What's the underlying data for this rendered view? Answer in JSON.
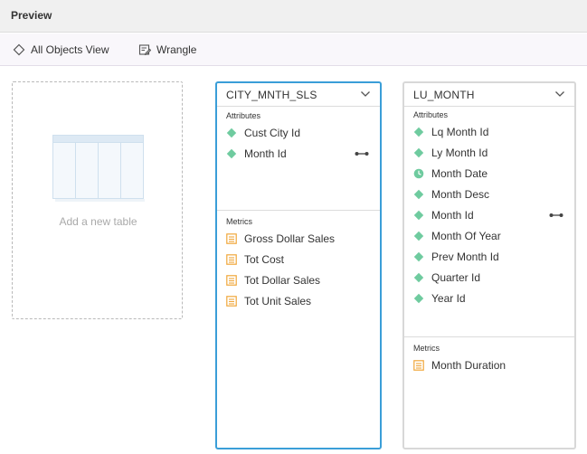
{
  "header": {
    "title": "Preview"
  },
  "toolbar": {
    "all_objects_label": "All Objects View",
    "wrangle_label": "Wrangle"
  },
  "add_table": {
    "label": "Add a new table"
  },
  "tables": [
    {
      "name": "CITY_MNTH_SLS",
      "attributes_label": "Attributes",
      "metrics_label": "Metrics",
      "attributes": [
        {
          "label": "Cust City Id",
          "icon": "attribute-diamond-icon"
        },
        {
          "label": "Month Id",
          "icon": "attribute-diamond-icon",
          "key": true
        }
      ],
      "metrics": [
        {
          "label": "Gross Dollar Sales",
          "icon": "metric-icon"
        },
        {
          "label": "Tot Cost",
          "icon": "metric-icon"
        },
        {
          "label": "Tot Dollar Sales",
          "icon": "metric-icon"
        },
        {
          "label": "Tot Unit Sales",
          "icon": "metric-icon"
        }
      ]
    },
    {
      "name": "LU_MONTH",
      "attributes_label": "Attributes",
      "metrics_label": "Metrics",
      "attributes": [
        {
          "label": "Lq Month Id",
          "icon": "attribute-diamond-icon"
        },
        {
          "label": "Ly Month Id",
          "icon": "attribute-diamond-icon"
        },
        {
          "label": "Month Date",
          "icon": "attribute-date-icon"
        },
        {
          "label": "Month Desc",
          "icon": "attribute-diamond-icon"
        },
        {
          "label": "Month Id",
          "icon": "attribute-diamond-icon",
          "key": true
        },
        {
          "label": "Month Of Year",
          "icon": "attribute-diamond-icon"
        },
        {
          "label": "Prev Month Id",
          "icon": "attribute-diamond-icon"
        },
        {
          "label": "Quarter Id",
          "icon": "attribute-diamond-icon"
        },
        {
          "label": "Year Id",
          "icon": "attribute-diamond-icon"
        }
      ],
      "metrics": [
        {
          "label": "Month Duration",
          "icon": "metric-icon"
        }
      ]
    }
  ],
  "colors": {
    "accent_blue": "#3a9ed8",
    "attribute_green": "#6fcb9f",
    "metric_orange": "#f0a73a"
  }
}
